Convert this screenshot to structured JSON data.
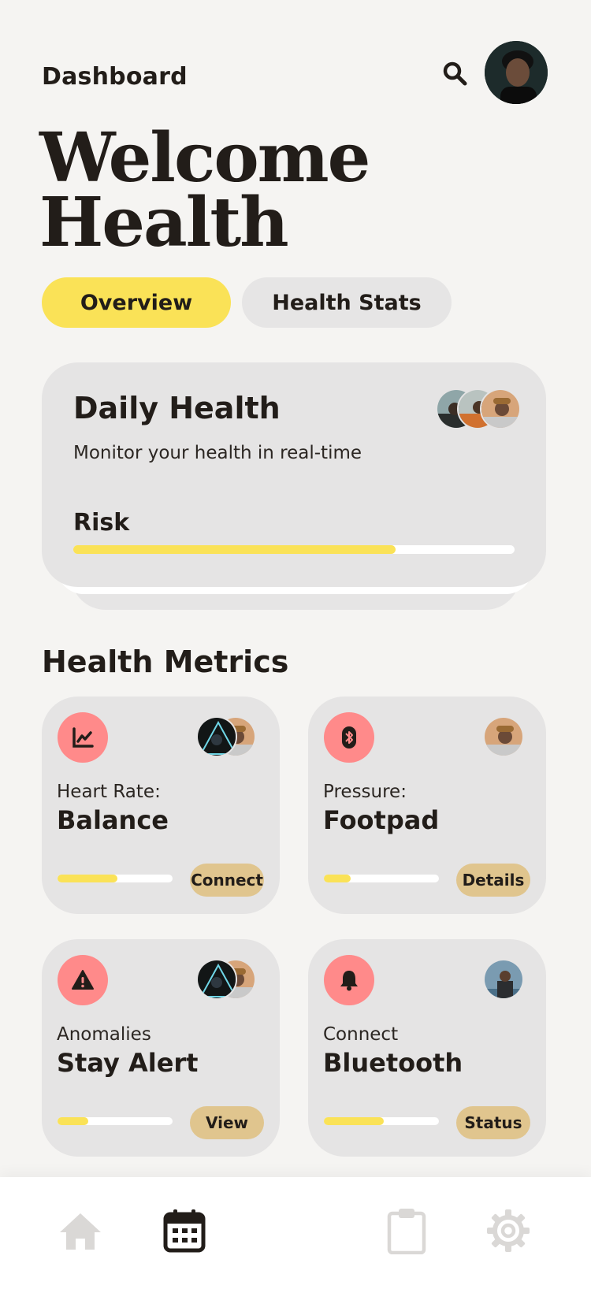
{
  "header": {
    "title": "Dashboard",
    "search_icon": "search-icon",
    "avatar": "user-avatar"
  },
  "hero": {
    "line1": "Welcome",
    "line2": "Health"
  },
  "tabs": [
    {
      "label": "Overview",
      "active": true
    },
    {
      "label": "Health Stats",
      "active": false
    }
  ],
  "daily": {
    "title": "Daily Health",
    "subtitle": "Monitor your health in real-time",
    "risk_label": "Risk",
    "risk_progress": 0.73
  },
  "metrics_section": {
    "title": "Health Metrics",
    "cards": [
      {
        "icon": "chart-line-icon",
        "label": "Heart Rate:",
        "value": "Balance",
        "progress": 0.52,
        "button": "Connect"
      },
      {
        "icon": "bluetooth-icon",
        "label": "Pressure:",
        "value": "Footpad",
        "progress": 0.23,
        "button": "Details"
      },
      {
        "icon": "warning-icon",
        "label": "Anomalies",
        "value": "Stay Alert",
        "progress": 0.27,
        "button": "View"
      },
      {
        "icon": "bell-icon",
        "label": "Connect",
        "value": "Bluetooth",
        "progress": 0.52,
        "button": "Status"
      }
    ]
  },
  "bottom_nav": [
    "home-icon",
    "calendar-icon",
    "clipboard-icon",
    "settings-icon"
  ],
  "colors": {
    "background": "#f5f4f2",
    "accent_yellow": "#fae257",
    "card_gray": "#e5e4e4",
    "icon_pink": "#ff8a8a",
    "button_tan": "#e0c58e",
    "text_dark": "#221d19"
  }
}
